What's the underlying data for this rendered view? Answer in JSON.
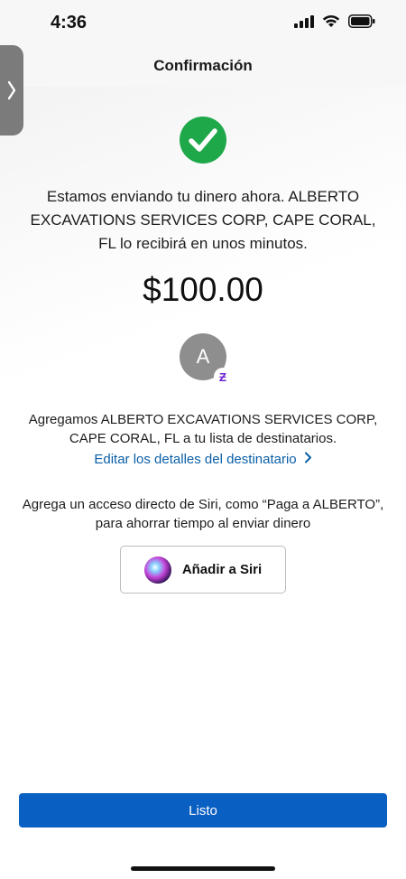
{
  "status_bar": {
    "time": "4:36",
    "icons": [
      "signal-icon",
      "wifi-icon",
      "battery-icon"
    ]
  },
  "header": {
    "title": "Confirmación"
  },
  "side_handle": {
    "icon": "chevron-right-icon"
  },
  "confirmation": {
    "icon": "check-circle-icon",
    "message": "Estamos enviando tu dinero ahora. ALBERTO EXCAVATIONS SERVICES CORP, CAPE CORAL, FL lo recibirá en unos minutos.",
    "amount": "$100.00"
  },
  "recipient": {
    "avatar_initial": "A",
    "badge_icon": "zelle-icon",
    "badge_glyph": "Ƶ",
    "added_text": "Agregamos ALBERTO EXCAVATIONS SERVICES CORP, CAPE CORAL, FL a tu lista de destinatarios.",
    "edit_link": "Editar los detalles del destinatario"
  },
  "siri": {
    "prompt": "Agrega un acceso directo de Siri, como “Paga a ALBERTO”, para ahorrar tiempo al enviar dinero",
    "button_label": "Añadir a Siri"
  },
  "footer": {
    "done_label": "Listo"
  },
  "colors": {
    "accent": "#0a5fc2",
    "link": "#0a5fa8",
    "success": "#1fa84a",
    "zelle": "#6d1ed4"
  }
}
